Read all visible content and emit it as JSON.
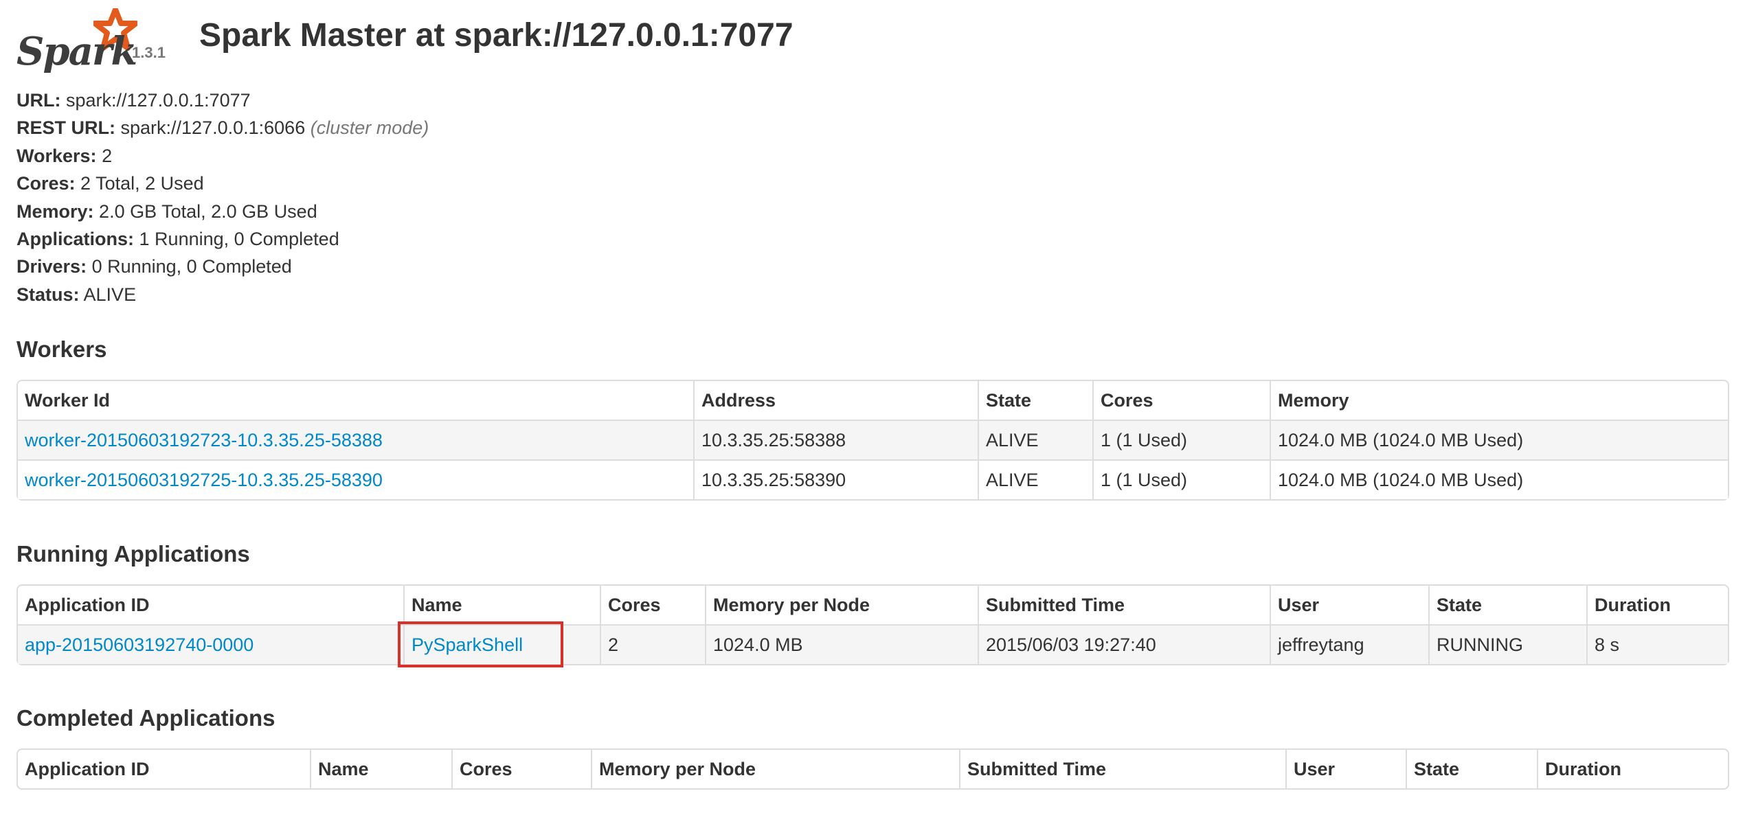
{
  "header": {
    "logo_text": "Spark",
    "version": "1.3.1",
    "title": "Spark Master at spark://127.0.0.1:7077"
  },
  "summary": [
    {
      "label": "URL:",
      "value": "spark://127.0.0.1:7077",
      "note": ""
    },
    {
      "label": "REST URL:",
      "value": "spark://127.0.0.1:6066",
      "note": "(cluster mode)"
    },
    {
      "label": "Workers:",
      "value": "2",
      "note": ""
    },
    {
      "label": "Cores:",
      "value": "2 Total, 2 Used",
      "note": ""
    },
    {
      "label": "Memory:",
      "value": "2.0 GB Total, 2.0 GB Used",
      "note": ""
    },
    {
      "label": "Applications:",
      "value": "1 Running, 0 Completed",
      "note": ""
    },
    {
      "label": "Drivers:",
      "value": "0 Running, 0 Completed",
      "note": ""
    },
    {
      "label": "Status:",
      "value": "ALIVE",
      "note": ""
    }
  ],
  "workers": {
    "heading": "Workers",
    "columns": [
      "Worker Id",
      "Address",
      "State",
      "Cores",
      "Memory"
    ],
    "rows": [
      [
        "worker-20150603192723-10.3.35.25-58388",
        "10.3.35.25:58388",
        "ALIVE",
        "1 (1 Used)",
        "1024.0 MB (1024.0 MB Used)"
      ],
      [
        "worker-20150603192725-10.3.35.25-58390",
        "10.3.35.25:58390",
        "ALIVE",
        "1 (1 Used)",
        "1024.0 MB (1024.0 MB Used)"
      ]
    ]
  },
  "running": {
    "heading": "Running Applications",
    "columns": [
      "Application ID",
      "Name",
      "Cores",
      "Memory per Node",
      "Submitted Time",
      "User",
      "State",
      "Duration"
    ],
    "rows": [
      [
        "app-20150603192740-0000",
        "PySparkShell",
        "2",
        "1024.0 MB",
        "2015/06/03 19:27:40",
        "jeffreytang",
        "RUNNING",
        "8 s"
      ]
    ]
  },
  "completed": {
    "heading": "Completed Applications",
    "columns": [
      "Application ID",
      "Name",
      "Cores",
      "Memory per Node",
      "Submitted Time",
      "User",
      "State",
      "Duration"
    ]
  },
  "colors": {
    "link": "#0088cc",
    "highlight": "#d9302a",
    "logo_star": "#e25a1c"
  }
}
